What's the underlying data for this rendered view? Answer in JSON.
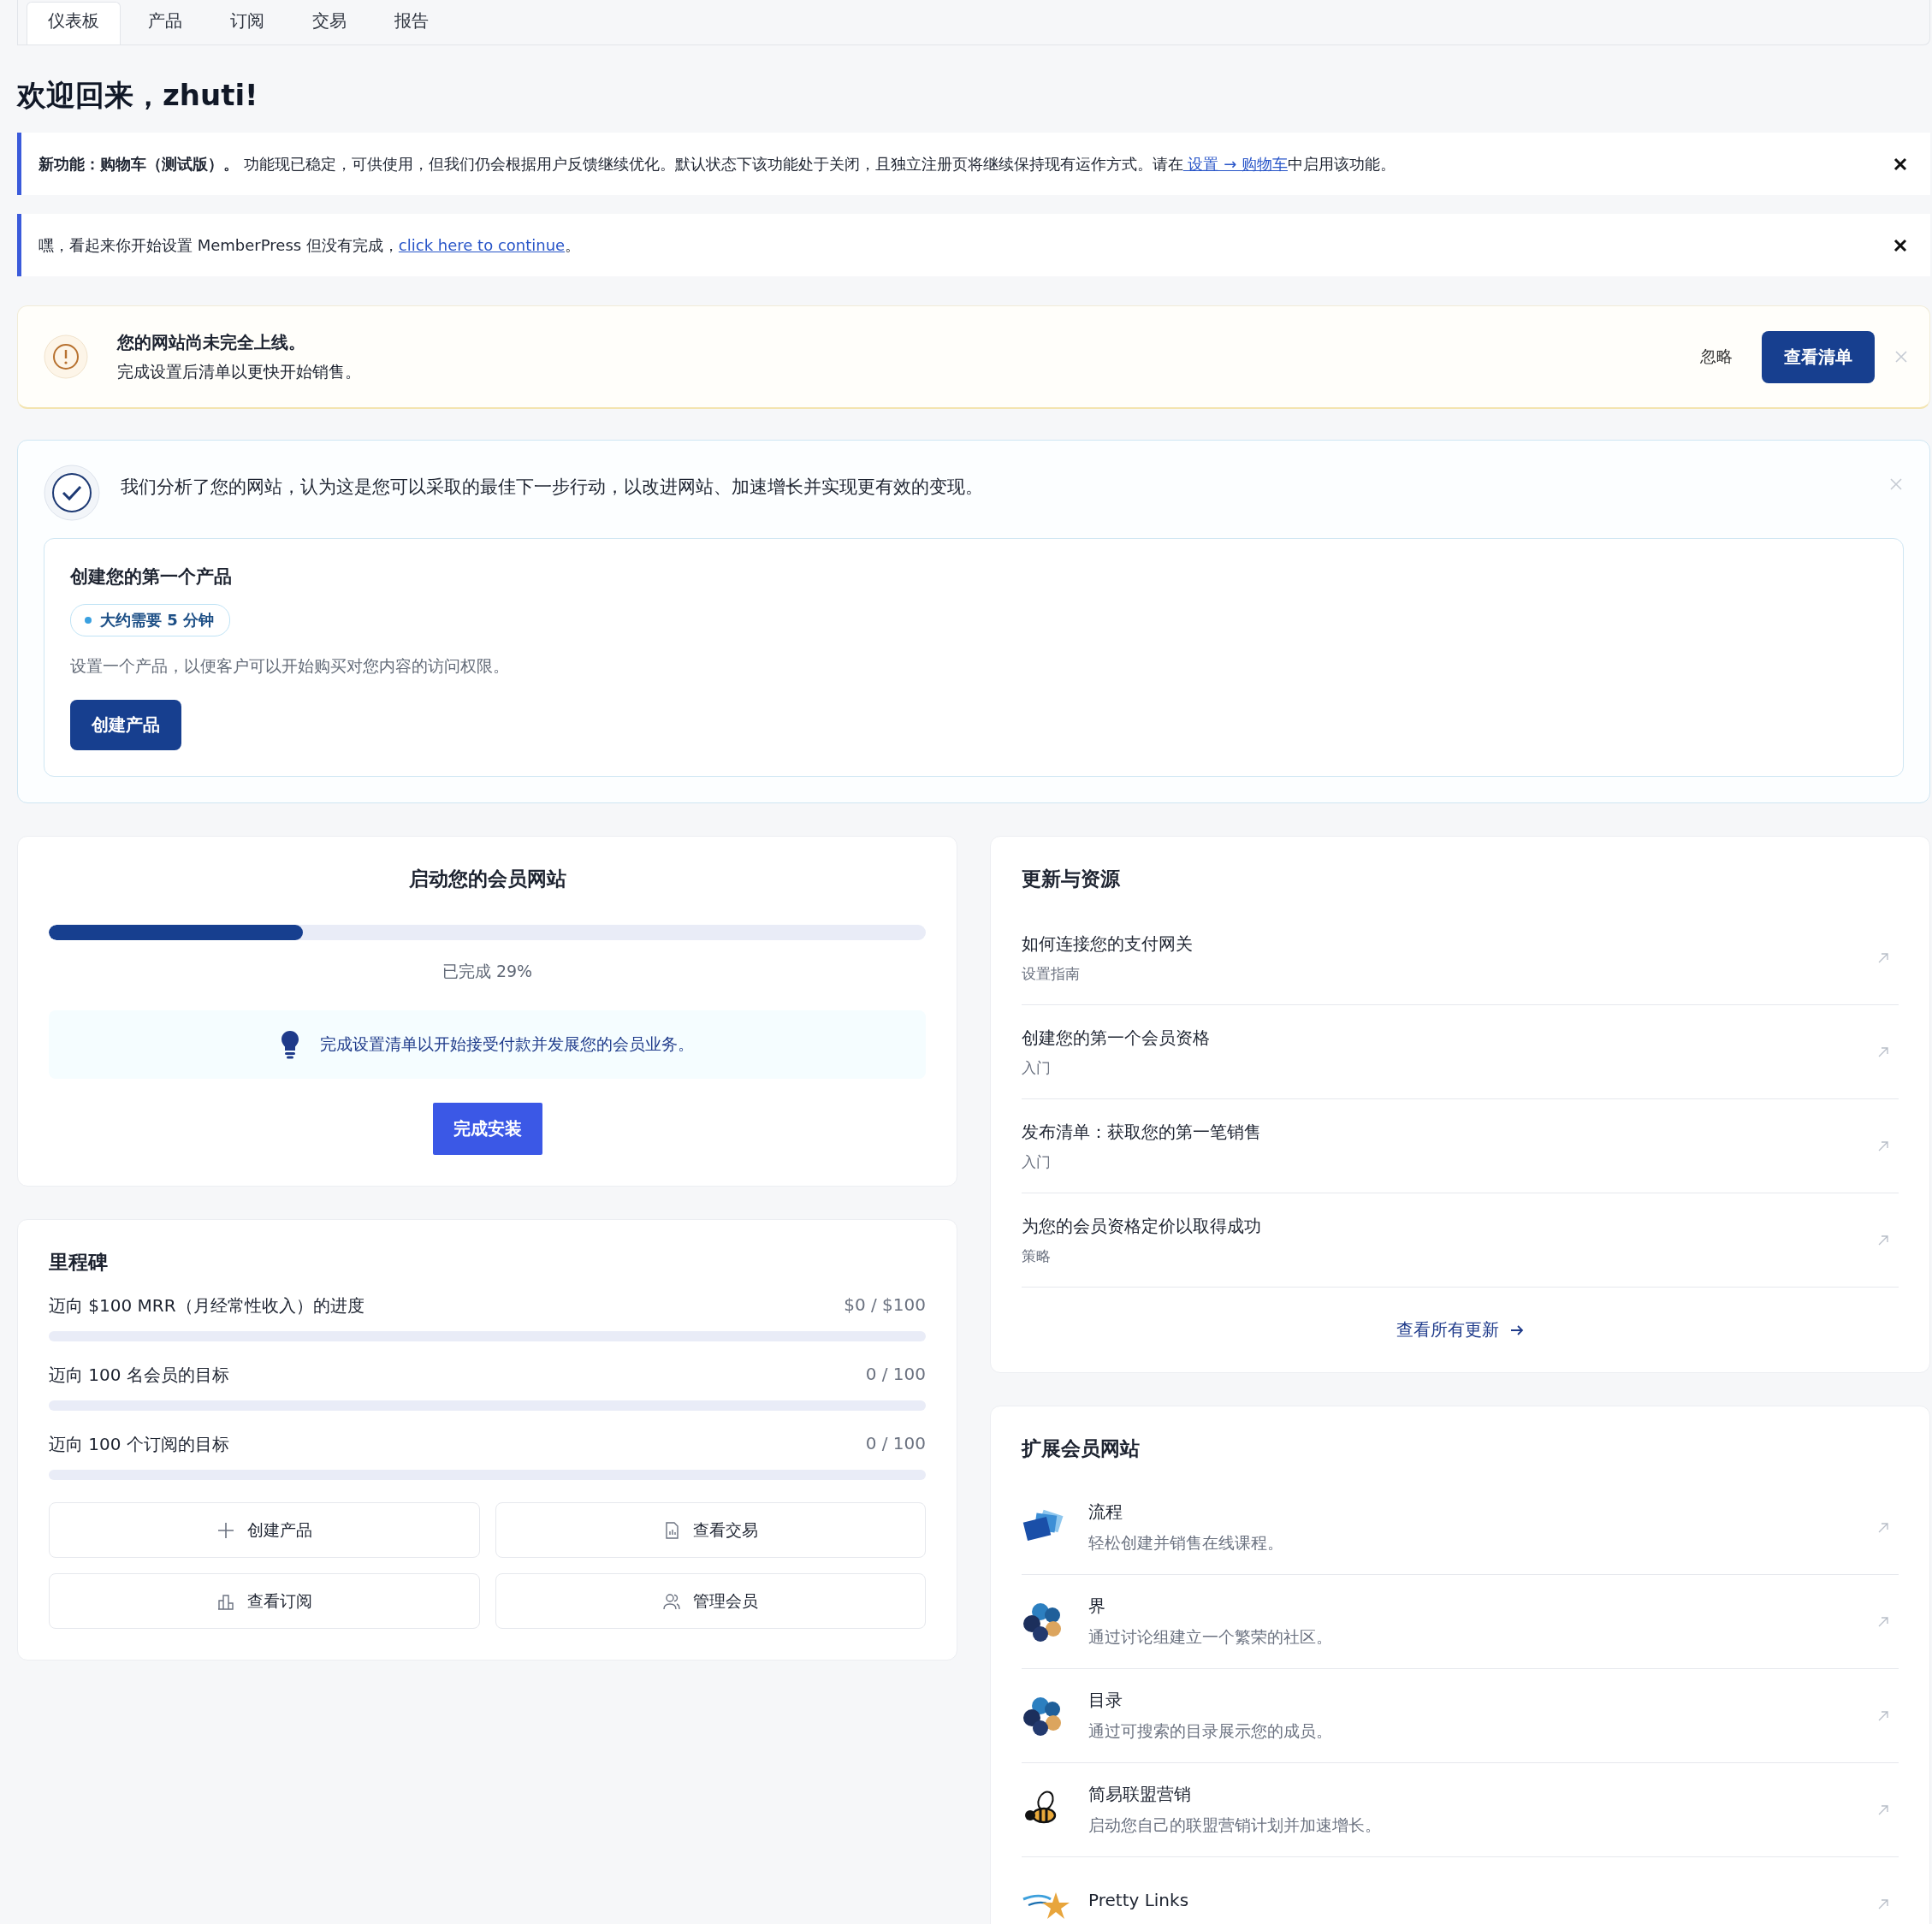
{
  "tabs": [
    {
      "label": "仪表板",
      "selected": true
    },
    {
      "label": "产品",
      "selected": false
    },
    {
      "label": "订阅",
      "selected": false
    },
    {
      "label": "交易",
      "selected": false
    },
    {
      "label": "报告",
      "selected": false
    }
  ],
  "welcome_title": "欢迎回来，zhuti!",
  "notices": [
    {
      "text": "**新功能：购物车（测试版）。** 功能现已稳定，可供使用，但我们仍会根据用户反馈继续优化。默认状态下该功能处于关闭，且独立注册页将继续保持现有运作方式。请在",
      "link": " 设置 → 购物车",
      "after": "中启用该功能。"
    },
    {
      "text": "嘿，看起来你开始设置 MemberPress 但没有完成，",
      "link": "click here to continue",
      "after": "。"
    }
  ],
  "launch_warning": {
    "title": "您的网站尚未完全上线。",
    "subtitle": "完成设置后清单以更快开始销售。",
    "dismiss": "忽略",
    "button": "查看清单"
  },
  "analysis": {
    "message": "我们分析了您的网站，认为这是您可以采取的最佳下一步行动，以改进网站、加速增长并实现更有效的变现。",
    "task": {
      "title": "创建您的第一个产品",
      "time_badge": "大约需要 5 分钟",
      "description": "设置一个产品，以便客户可以开始购买对您内容的访问权限。",
      "button": "创建产品"
    }
  },
  "launch_card": {
    "title": "启动您的会员网站",
    "level": 0.29,
    "progress_label": "已完成 29%",
    "tip": "完成设置清单以开始接受付款并发展您的会员业务。",
    "button": "完成安装"
  },
  "milestones": {
    "title": "里程碑",
    "items": [
      {
        "label": "迈向 $100 MRR（月经常性收入）的进度",
        "value": "$0 / $100",
        "level": 0
      },
      {
        "label": "迈向 100 名会员的目标",
        "value": "0 / 100",
        "level": 0
      },
      {
        "label": "迈向 100 个订阅的目标",
        "value": "0 / 100",
        "level": 0
      }
    ],
    "actions": [
      {
        "label": "创建产品",
        "kind": "plus"
      },
      {
        "label": "查看交易",
        "kind": "document"
      },
      {
        "label": "查看订阅",
        "kind": "chart"
      },
      {
        "label": "管理会员",
        "kind": "users"
      }
    ]
  },
  "updates": {
    "title": "更新与资源",
    "items": [
      {
        "title": "如何连接您的支付网关",
        "category": "设置指南"
      },
      {
        "title": "创建您的第一个会员资格",
        "category": "入门"
      },
      {
        "title": "发布清单：获取您的第一笔销售",
        "category": "入门"
      },
      {
        "title": "为您的会员资格定价以取得成功",
        "category": "策略"
      }
    ],
    "footer_link": "查看所有更新"
  },
  "extend": {
    "title": "扩展会员网站",
    "items": [
      {
        "name": "流程",
        "description": "轻松创建并销售在线课程。",
        "kind": "cards"
      },
      {
        "name": "界",
        "description": "通过讨论组建立一个繁荣的社区。",
        "kind": "circles"
      },
      {
        "name": "目录",
        "description": "通过可搜索的目录展示您的成员。",
        "kind": "circles"
      },
      {
        "name": "简易联盟营销",
        "description": "启动您自己的联盟营销计划并加速增长。",
        "kind": "bee"
      },
      {
        "name": "Pretty Links",
        "kind": "star"
      }
    ]
  }
}
